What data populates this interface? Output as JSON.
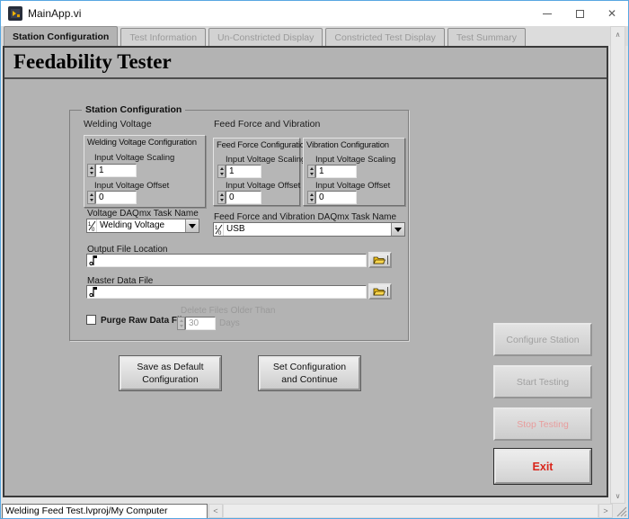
{
  "window": {
    "title": "MainApp.vi"
  },
  "tabs": [
    {
      "label": "Station Configuration",
      "active": true
    },
    {
      "label": "Test Information",
      "active": false
    },
    {
      "label": "Un-Constricted Display",
      "active": false
    },
    {
      "label": "Constricted Test Display",
      "active": false
    },
    {
      "label": "Test Summary",
      "active": false
    }
  ],
  "banner": {
    "title": "Feedability Tester"
  },
  "station": {
    "group_label": "Station Configuration",
    "welding": {
      "section_label": "Welding Voltage",
      "cluster_title": "Welding Voltage Configuration",
      "scaling_label": "Input Voltage Scaling",
      "scaling_value": "1",
      "offset_label": "Input Voltage Offset",
      "offset_value": "0",
      "task_label": "Voltage DAQmx Task Name",
      "task_value": "Welding Voltage"
    },
    "feed_force_vibration": {
      "section_label": "Feed Force and Vibration",
      "feed_force": {
        "cluster_title": "Feed Force Configuration",
        "scaling_label": "Input Voltage Scaling",
        "scaling_value": "1",
        "offset_label": "Input Voltage Offset",
        "offset_value": "0"
      },
      "vibration": {
        "cluster_title": "Vibration Configuration",
        "scaling_label": "Input Voltage Scaling",
        "scaling_value": "1",
        "offset_label": "Input Voltage Offset",
        "offset_value": "0"
      },
      "task_label": "Feed Force and Vibration DAQmx Task Name",
      "task_value": "USB"
    },
    "output_file": {
      "label": "Output File Location",
      "value": ""
    },
    "master_file": {
      "label": "Master Data File",
      "value": ""
    },
    "purge": {
      "label": "Purge Raw Data Files?",
      "checked": false,
      "delete_label": "Delete Files Older Than",
      "days_value": "30",
      "days_unit": "Days"
    }
  },
  "actions": {
    "save_default": {
      "line1": "Save as Default",
      "line2": "Configuration"
    },
    "set_continue": {
      "line1": "Set Configuration",
      "line2": "and Continue"
    }
  },
  "side_buttons": {
    "configure": {
      "label": "Configure Station",
      "enabled": false
    },
    "start": {
      "label": "Start Testing",
      "enabled": false
    },
    "stop": {
      "label": "Stop Testing",
      "enabled": false
    },
    "exit": {
      "label": "Exit",
      "enabled": true
    }
  },
  "statusbar": {
    "target": "Welding Feed Test.lvproj/My Computer"
  },
  "colors": {
    "panel_gray": "#b3b3b3",
    "window_border_blue": "#58a7e1",
    "exit_red": "#d9261c",
    "stop_disabled_red": "#e89c9c",
    "disabled_text": "#9a9a9a"
  }
}
